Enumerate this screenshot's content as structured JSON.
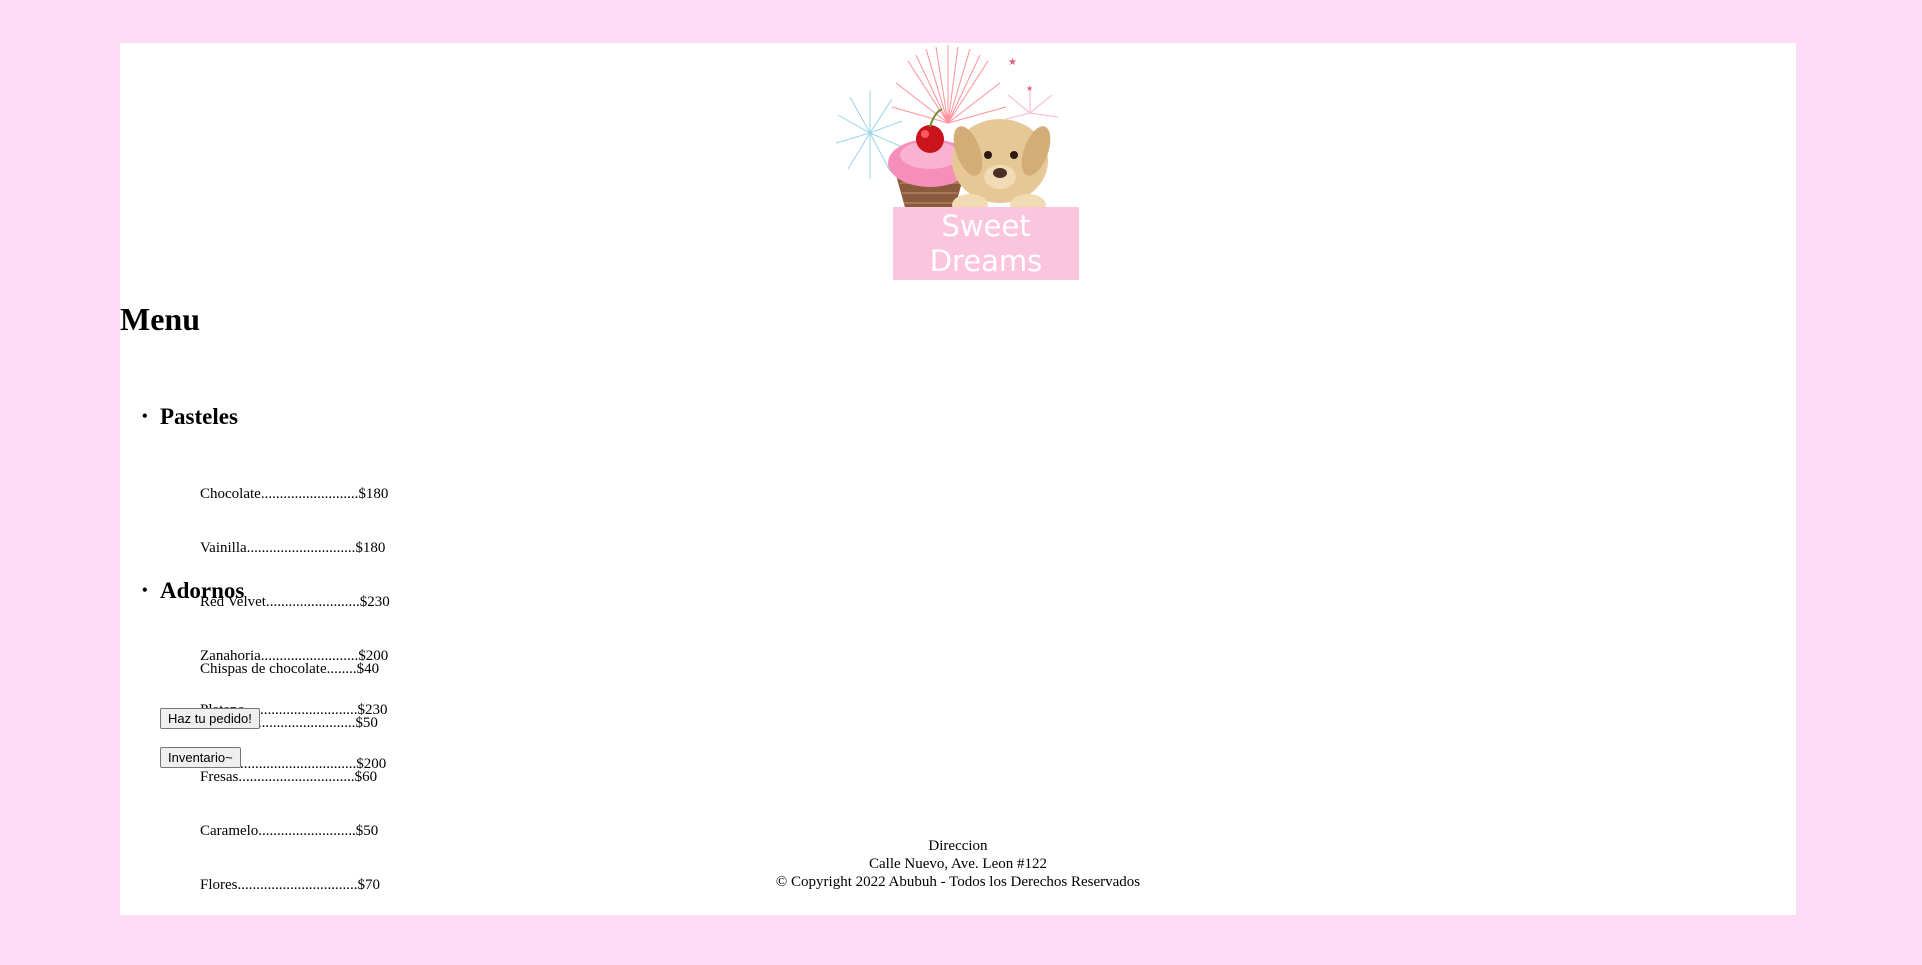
{
  "logo": {
    "text_line1": "Sweet",
    "text_line2": "Dreams",
    "banner_color": "#fcc5de"
  },
  "menu": {
    "title": "Menu",
    "sections": [
      {
        "name": "Pasteles",
        "items": [
          "Chocolate..........................$180",
          "Vainilla.............................$180",
          "Red Velvet.........................$230",
          "Zanahoria..........................$200",
          "Platano..............................$230",
          "Fresa.................................$200"
        ]
      },
      {
        "name": "Adornos",
        "items": [
          "Chispas de chocolate........$40",
          "Nuez.................................$50",
          "Fresas...............................$60",
          "Caramelo..........................$50",
          "Flores................................$70"
        ]
      }
    ]
  },
  "buttons": {
    "order": "Haz tu pedido!",
    "inventory": "Inventario~"
  },
  "footer": {
    "line1": "Direccion",
    "line2": "Calle Nuevo, Ave. Leon #122",
    "line3": "© Copyright 2022 Abubuh - Todos los Derechos Reservados"
  },
  "colors": {
    "page_background": "#ffdcf5",
    "content_background": "#ffffff"
  }
}
